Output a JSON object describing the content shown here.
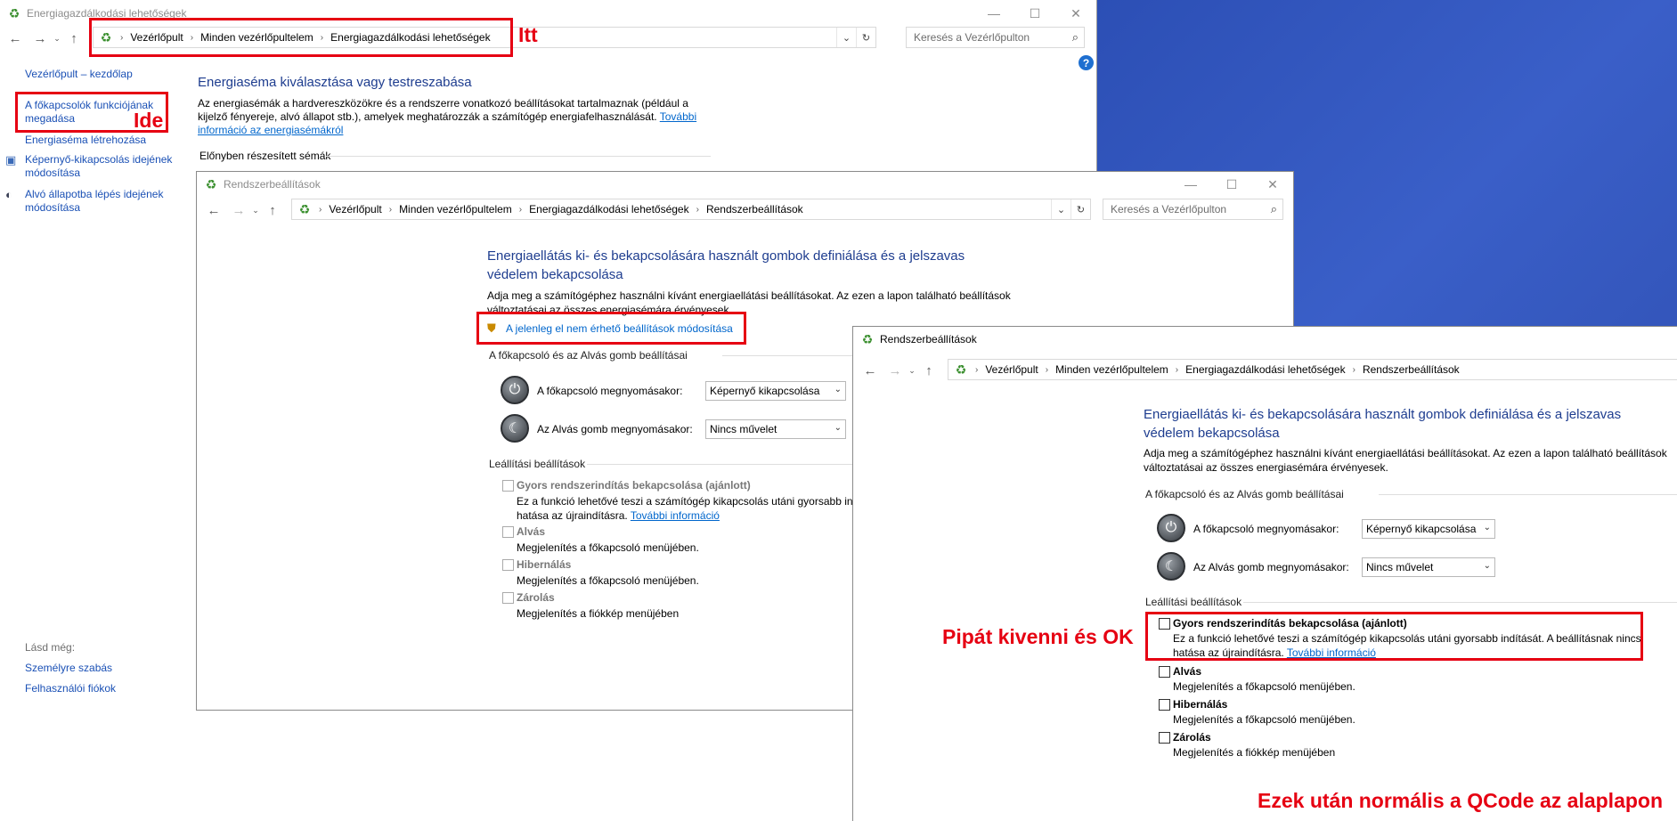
{
  "annotations": {
    "itt": "Itt",
    "ide": "Ide",
    "pipat": "Pipát kivenni és OK",
    "ezek": "Ezek után normális a QCode az alaplapon"
  },
  "w1": {
    "title": "Energiagazdálkodási lehetőségek",
    "breadcrumb": [
      "Vezérlőpult",
      "Minden vezérlőpultelem",
      "Energiagazdálkodási lehetőségek"
    ],
    "search_placeholder": "Keresés a Vezérlőpulton",
    "sidebar": {
      "home": "Vezérlőpult – kezdőlap",
      "item1": "A főkapcsolók funkciójának megadása",
      "item2": "Energiaséma létrehozása",
      "item3": "Képernyő-kikapcsolás idejének módosítása",
      "item4": "Alvó állapotba lépés idejének módosítása",
      "see_also": "Lásd még:",
      "sa1": "Személyre szabás",
      "sa2": "Felhasználói fiókok"
    },
    "main": {
      "heading": "Energiaséma kiválasztása vagy testreszabása",
      "desc": "Az energiasémák a hardvereszközökre és a rendszerre vonatkozó beállításokat tartalmaznak (például a kijelző fényereje, alvó állapot stb.), amelyek meghatározzák a számítógép energiafelhasználását.",
      "more_link": "További információ az energiasémákról",
      "preferred": "Előnyben részesített sémák"
    }
  },
  "sys": {
    "title": "Rendszerbeállítások",
    "breadcrumb": [
      "Vezérlőpult",
      "Minden vezérlőpultelem",
      "Energiagazdálkodási lehetőségek",
      "Rendszerbeállítások"
    ],
    "search_placeholder": "Keresés a Vezérlőpulton",
    "heading": "Energiaellátás ki- és bekapcsolására használt gombok definiálása és a jelszavas védelem bekapcsolása",
    "intro": "Adja meg a számítógéphez használni kívánt energiaellátási beállításokat. Az ezen a lapon található beállítások változtatásai az összes energiasémára érvényesek.",
    "change_link": "A jelenleg el nem érhető beállítások módosítása",
    "group1": "A főkapcsoló és az Alvás gomb beállításai",
    "power_label": "A főkapcsoló megnyomásakor:",
    "power_value": "Képernyő kikapcsolása",
    "sleep_label": "Az Alvás gomb megnyomásakor:",
    "sleep_value": "Nincs művelet",
    "group2": "Leállítási beállítások",
    "fast": "Gyors rendszerindítás bekapcsolása (ajánlott)",
    "fast_desc": "Ez a funkció lehetővé teszi a számítógép kikapcsolás utáni gyorsabb indítását. A beállításnak nincs hatása az újraindításra.",
    "fast_desc_w2": "Ez a funkció lehetővé teszi a számítógép kikapcsolás utáni gyorsabb indít",
    "fast_desc2": "hatása az újraindításra.",
    "more": "További információ",
    "alvas": "Alvás",
    "alvas_desc": "Megjelenítés a főkapcsoló menüjében.",
    "hib": "Hibernálás",
    "hib_desc": "Megjelenítés a főkapcsoló menüjében.",
    "zar": "Zárolás",
    "zar_desc": "Megjelenítés a fiókkép menüjében"
  }
}
